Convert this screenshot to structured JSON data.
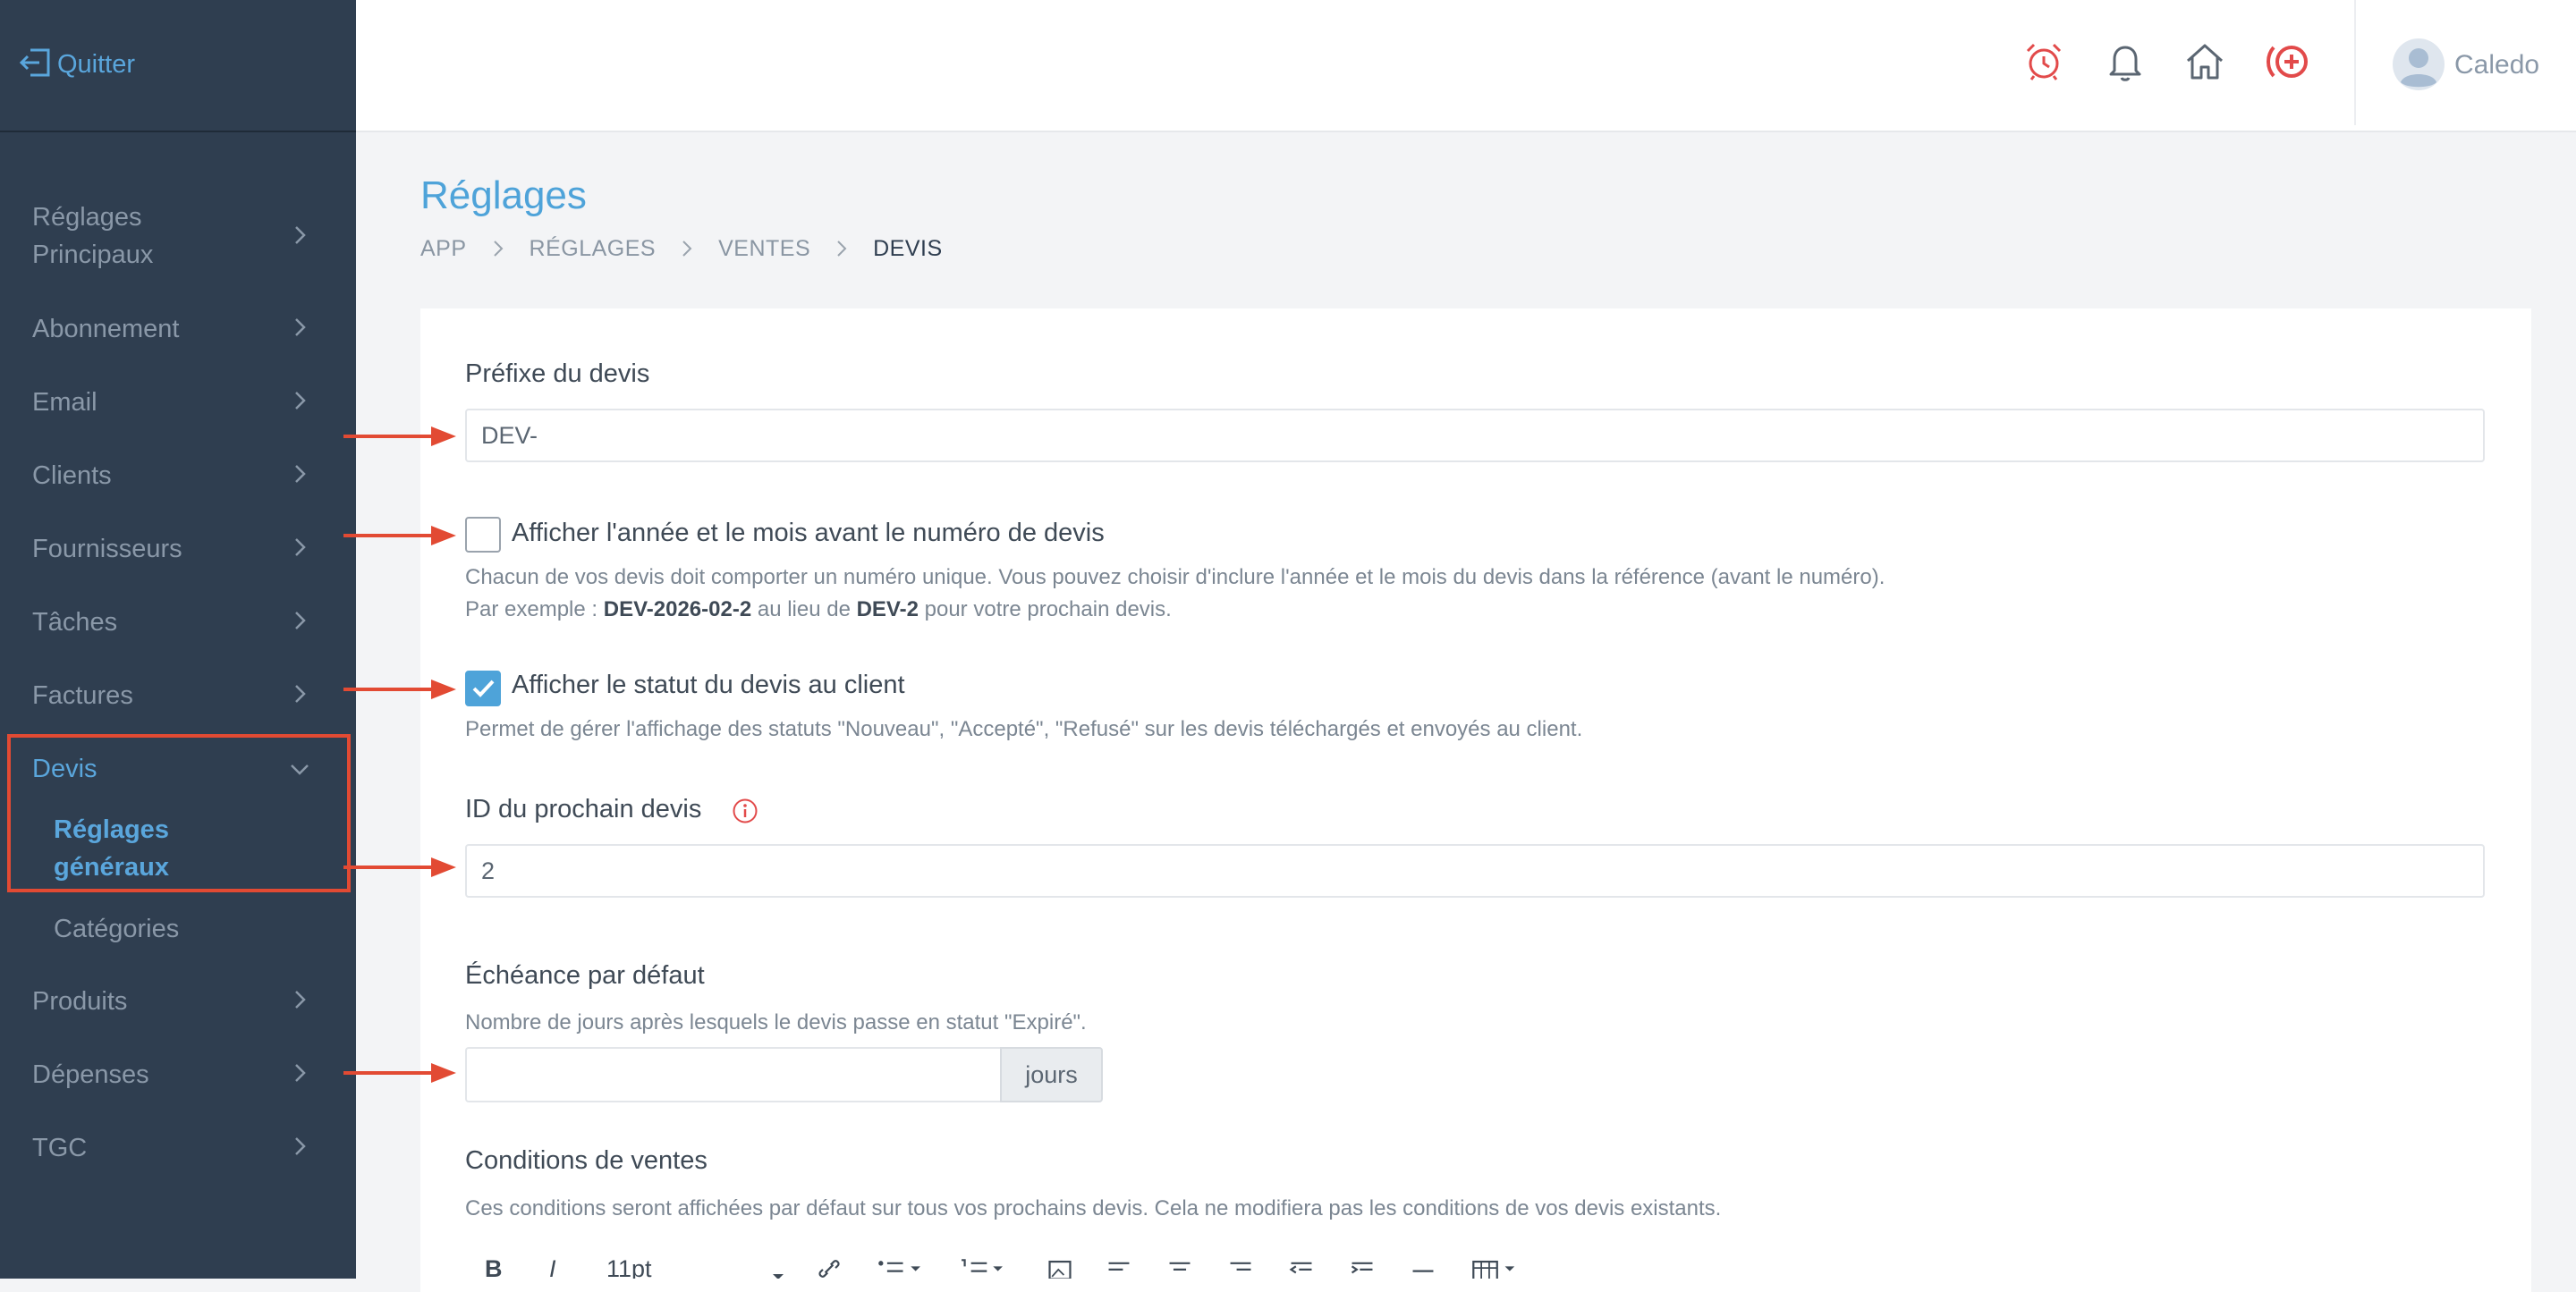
{
  "sidebar": {
    "quit_label": "Quitter",
    "items": [
      {
        "label_line1": "Réglages",
        "label_line2": "Principaux"
      },
      {
        "label": "Abonnement"
      },
      {
        "label": "Email"
      },
      {
        "label": "Clients"
      },
      {
        "label": "Fournisseurs"
      },
      {
        "label": "Tâches"
      },
      {
        "label": "Factures"
      },
      {
        "label": "Devis"
      },
      {
        "label": "Produits"
      },
      {
        "label": "Dépenses"
      },
      {
        "label": "TGC"
      }
    ],
    "devis_sub": {
      "current_line1": "Réglages",
      "current_line2": "généraux",
      "other": "Catégories"
    }
  },
  "header": {
    "icons": [
      "alarm-clock-icon",
      "bell-icon",
      "home-icon",
      "add-circle-icon"
    ],
    "user_name": "Caledo",
    "accent_color": "#e24a4a"
  },
  "page": {
    "title": "Réglages",
    "breadcrumb": [
      "APP",
      "RÉGLAGES",
      "VENTES",
      "DEVIS"
    ]
  },
  "form": {
    "prefix_label": "Préfixe du devis",
    "prefix_value": "DEV-",
    "show_year_label": "Afficher l'année et le mois avant le numéro de devis",
    "show_year_checked": false,
    "show_year_help1": "Chacun de vos devis doit comporter un numéro unique. Vous pouvez choisir d'inclure l'année et le mois du devis dans la référence (avant le numéro).",
    "show_year_help2_prefix": "Par exemple : ",
    "show_year_help2_example": "DEV-2026-02-2",
    "show_year_help2_mid": " au lieu de ",
    "show_year_help2_example2": "DEV-2",
    "show_year_help2_suffix": " pour votre prochain devis.",
    "show_status_label": "Afficher le statut du devis au client",
    "show_status_checked": true,
    "show_status_help": "Permet de gérer l'affichage des statuts \"Nouveau\", \"Accepté\", \"Refusé\" sur les devis téléchargés et envoyés au client.",
    "next_id_label": "ID du prochain devis",
    "next_id_value": "2",
    "due_label": "Échéance par défaut",
    "due_help": "Nombre de jours après lesquels le devis passe en statut \"Expiré\".",
    "due_value": "",
    "due_addon": "jours",
    "conditions_label": "Conditions de ventes",
    "conditions_help": "Ces conditions seront affichées par défaut sur tous vos prochains devis. Cela ne modifiera pas les conditions de vos devis existants.",
    "toolbar_font_size": "11pt"
  },
  "colors": {
    "sidebar_bg": "#2f3e50",
    "accent_blue": "#4ea3d9",
    "annotation_red": "#e24a33"
  }
}
